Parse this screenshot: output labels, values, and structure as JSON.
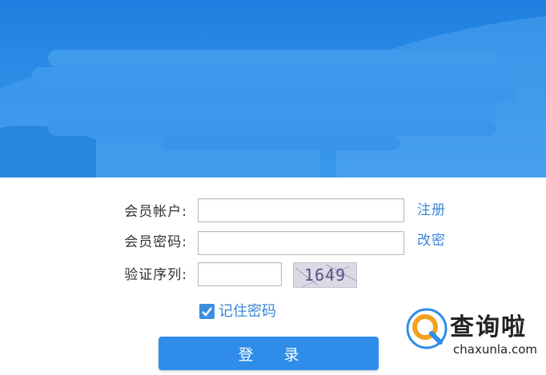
{
  "form": {
    "account_label": "会员帐户:",
    "password_label": "会员密码:",
    "captcha_label": "验证序列:",
    "account_value": "",
    "password_value": "",
    "captcha_value": "",
    "register_link": "注册",
    "change_password_link": "改密",
    "captcha_code": "1649",
    "remember_checked": true,
    "remember_label": "记住密码",
    "login_button": "登 录"
  },
  "watermark": {
    "title": "查询啦",
    "domain": "chaxunla.com"
  },
  "colors": {
    "banner": "#2d8ce6",
    "link": "#3a86d6",
    "button": "#2f8ce8",
    "captcha_bg": "#dcd9e4"
  }
}
